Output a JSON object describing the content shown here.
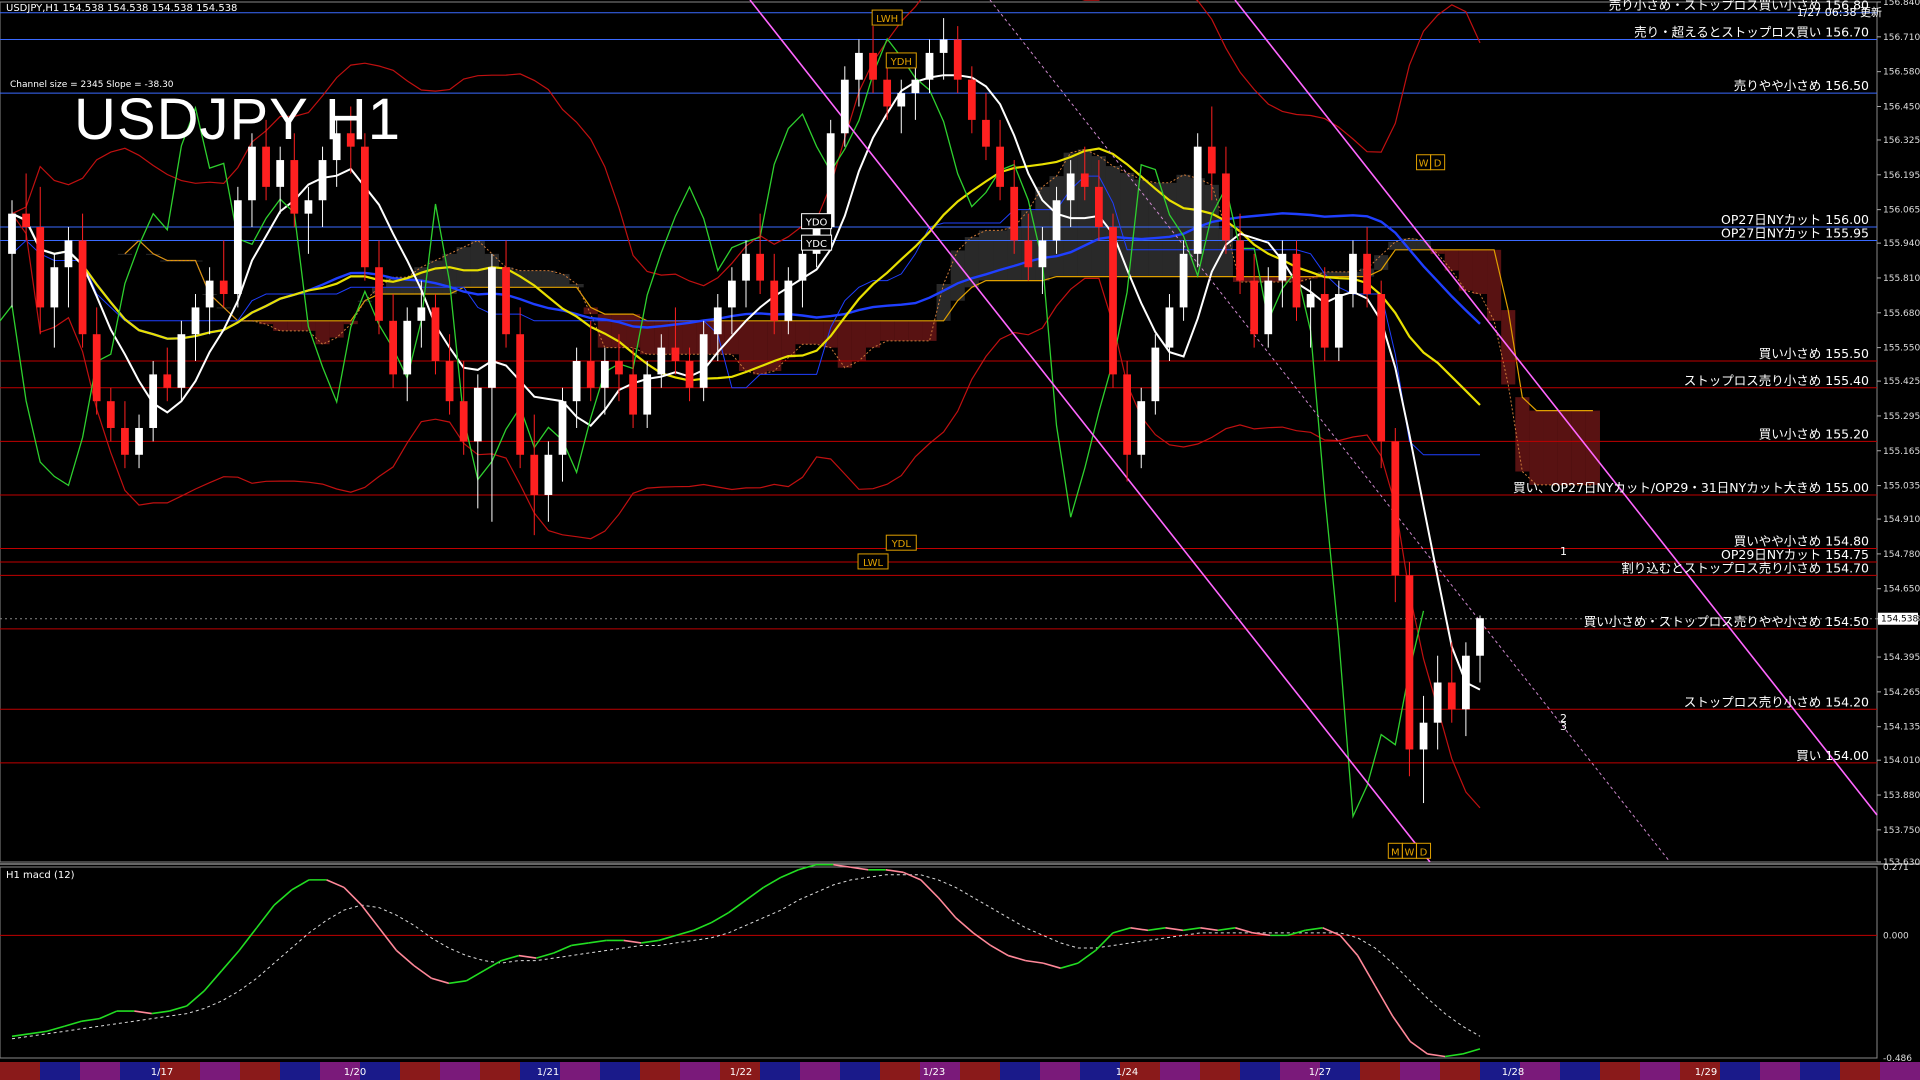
{
  "header": {
    "ohlc": "USDJPY,H1  154.538 154.538 154.538 154.538",
    "chart_title": "USDJPY H1",
    "channel_info": "Channel size = 2345 Slope = -38.30",
    "updated": "1/27 06:38 更新",
    "macd_label": "H1  macd (12)"
  },
  "colors": {
    "background": "#000000",
    "bull_candle": "#ffffff",
    "bear_candle": "#ff2020",
    "red_level": "#c00000",
    "blue_level": "#3a6aff",
    "cloud": "#a02020",
    "white_ma": "#ffffff",
    "yellow_ma": "#e8e000",
    "blue_ma": "#1f3fff",
    "green_line": "#2ed02e",
    "channel_magenta": "#ff66ff",
    "macd_pos": "#22dd22",
    "macd_neg": "#ff8899"
  },
  "chart_data": [
    {
      "type": "line",
      "title": "USDJPY H1",
      "ylim": [
        153.63,
        156.84
      ],
      "y_ticks": [
        156.84,
        156.71,
        156.58,
        156.45,
        156.325,
        156.195,
        156.065,
        155.94,
        155.81,
        155.68,
        155.55,
        155.425,
        155.295,
        155.165,
        155.035,
        154.91,
        154.78,
        154.65,
        154.538,
        154.395,
        154.265,
        154.135,
        154.01,
        153.88,
        153.75,
        153.63
      ],
      "x_labels": [
        "1/17",
        "1/20",
        "1/21",
        "1/22",
        "1/23",
        "1/24",
        "1/27",
        "1/28",
        "1/29"
      ],
      "current_price": 154.538,
      "levels": [
        {
          "price": 156.8,
          "label": "売り小さめ・ストップロス買い小さめ 156.80",
          "color": "blue"
        },
        {
          "price": 156.7,
          "label": "売り・超えるとストップロス買い 156.70",
          "color": "blue"
        },
        {
          "price": 156.5,
          "label": "売りやや小さめ 156.50",
          "color": "blue"
        },
        {
          "price": 156.0,
          "label": "OP27日NYカット 156.00",
          "color": "blue"
        },
        {
          "price": 155.95,
          "label": "OP27日NYカット 155.95",
          "color": "blue"
        },
        {
          "price": 155.5,
          "label": "買い小さめ 155.50",
          "color": "red"
        },
        {
          "price": 155.4,
          "label": "ストップロス売り小さめ 155.40",
          "color": "red"
        },
        {
          "price": 155.2,
          "label": "買い小さめ 155.20",
          "color": "red"
        },
        {
          "price": 155.0,
          "label": "買い、OP27日NYカット/OP29・31日NYカット大きめ 155.00",
          "color": "red"
        },
        {
          "price": 154.8,
          "label": "買いやや小さめ 154.80",
          "color": "red"
        },
        {
          "price": 154.75,
          "label": "OP29日NYカット 154.75",
          "color": "red"
        },
        {
          "price": 154.7,
          "label": "割り込むとストップロス売り小さめ 154.70",
          "color": "red"
        },
        {
          "price": 154.5,
          "label": "買い小さめ・ストップロス売りやや小さめ 154.50",
          "color": "red"
        },
        {
          "price": 154.2,
          "label": "ストップロス売り小さめ 154.20",
          "color": "red"
        },
        {
          "price": 154.0,
          "label": "買い 154.00",
          "color": "red"
        }
      ],
      "markers": [
        {
          "label": "LWH",
          "price": 156.78,
          "x_index": 62
        },
        {
          "label": "YDH",
          "price": 156.62,
          "x_index": 63
        },
        {
          "label": "YDO",
          "price": 156.02,
          "x_index": 57
        },
        {
          "label": "YDC",
          "price": 155.94,
          "x_index": 57
        },
        {
          "label": "YDL",
          "price": 154.82,
          "x_index": 63
        },
        {
          "label": "LWL",
          "price": 154.75,
          "x_index": 61
        },
        {
          "label": "W",
          "price": 156.24,
          "x_index": 100
        },
        {
          "label": "D",
          "price": 156.24,
          "x_index": 101
        },
        {
          "label": "M",
          "price": 153.67,
          "x_index": 98
        },
        {
          "label": "W",
          "price": 153.67,
          "x_index": 99
        },
        {
          "label": "D",
          "price": 153.67,
          "x_index": 100
        }
      ],
      "projections": [
        "1",
        "2",
        "3"
      ],
      "candles": [
        [
          155.9,
          156.1,
          155.7,
          156.05
        ],
        [
          156.05,
          156.2,
          155.95,
          156.0
        ],
        [
          156.0,
          156.15,
          155.6,
          155.7
        ],
        [
          155.7,
          155.9,
          155.55,
          155.85
        ],
        [
          155.85,
          156.0,
          155.7,
          155.95
        ],
        [
          155.95,
          156.05,
          155.55,
          155.6
        ],
        [
          155.6,
          155.7,
          155.3,
          155.35
        ],
        [
          155.35,
          155.4,
          155.2,
          155.25
        ],
        [
          155.25,
          155.35,
          155.1,
          155.15
        ],
        [
          155.15,
          155.3,
          155.1,
          155.25
        ],
        [
          155.25,
          155.5,
          155.2,
          155.45
        ],
        [
          155.45,
          155.55,
          155.35,
          155.4
        ],
        [
          155.4,
          155.65,
          155.35,
          155.6
        ],
        [
          155.6,
          155.75,
          155.5,
          155.7
        ],
        [
          155.7,
          155.85,
          155.6,
          155.8
        ],
        [
          155.8,
          155.95,
          155.7,
          155.75
        ],
        [
          155.75,
          156.15,
          155.7,
          156.1
        ],
        [
          156.1,
          156.35,
          156.0,
          156.3
        ],
        [
          156.3,
          156.4,
          156.1,
          156.15
        ],
        [
          156.15,
          156.3,
          156.05,
          156.25
        ],
        [
          156.25,
          156.35,
          156.0,
          156.05
        ],
        [
          156.05,
          156.15,
          155.9,
          156.1
        ],
        [
          156.1,
          156.3,
          156.0,
          156.25
        ],
        [
          156.25,
          156.4,
          156.15,
          156.35
        ],
        [
          156.35,
          156.45,
          156.2,
          156.3
        ],
        [
          156.3,
          156.35,
          155.8,
          155.85
        ],
        [
          155.85,
          155.95,
          155.6,
          155.65
        ],
        [
          155.65,
          155.75,
          155.4,
          155.45
        ],
        [
          155.45,
          155.7,
          155.35,
          155.65
        ],
        [
          155.65,
          155.8,
          155.55,
          155.7
        ],
        [
          155.7,
          155.75,
          155.45,
          155.5
        ],
        [
          155.5,
          155.6,
          155.3,
          155.35
        ],
        [
          155.35,
          155.5,
          155.15,
          155.2
        ],
        [
          155.2,
          155.45,
          154.95,
          155.4
        ],
        [
          155.4,
          155.9,
          154.9,
          155.85
        ],
        [
          155.85,
          155.95,
          155.55,
          155.6
        ],
        [
          155.6,
          155.7,
          155.1,
          155.15
        ],
        [
          155.15,
          155.3,
          154.85,
          155.0
        ],
        [
          155.0,
          155.2,
          154.9,
          155.15
        ],
        [
          155.15,
          155.4,
          155.05,
          155.35
        ],
        [
          155.35,
          155.55,
          155.25,
          155.5
        ],
        [
          155.5,
          155.65,
          155.35,
          155.4
        ],
        [
          155.4,
          155.55,
          155.3,
          155.5
        ],
        [
          155.5,
          155.6,
          155.35,
          155.45
        ],
        [
          155.45,
          155.55,
          155.25,
          155.3
        ],
        [
          155.3,
          155.5,
          155.25,
          155.45
        ],
        [
          155.45,
          155.6,
          155.4,
          155.55
        ],
        [
          155.55,
          155.7,
          155.45,
          155.5
        ],
        [
          155.5,
          155.55,
          155.35,
          155.4
        ],
        [
          155.4,
          155.65,
          155.35,
          155.6
        ],
        [
          155.6,
          155.75,
          155.5,
          155.7
        ],
        [
          155.7,
          155.85,
          155.6,
          155.8
        ],
        [
          155.8,
          155.95,
          155.7,
          155.9
        ],
        [
          155.9,
          156.05,
          155.75,
          155.8
        ],
        [
          155.8,
          155.9,
          155.6,
          155.65
        ],
        [
          155.65,
          155.85,
          155.6,
          155.8
        ],
        [
          155.8,
          155.95,
          155.7,
          155.9
        ],
        [
          155.9,
          156.05,
          155.85,
          156.0
        ],
        [
          156.0,
          156.4,
          155.95,
          156.35
        ],
        [
          156.35,
          156.6,
          156.3,
          156.55
        ],
        [
          156.55,
          156.7,
          156.45,
          156.65
        ],
        [
          156.65,
          156.75,
          156.5,
          156.55
        ],
        [
          156.55,
          156.65,
          156.4,
          156.45
        ],
        [
          156.45,
          156.55,
          156.35,
          156.5
        ],
        [
          156.5,
          156.6,
          156.4,
          156.55
        ],
        [
          156.55,
          156.7,
          156.5,
          156.65
        ],
        [
          156.65,
          156.78,
          156.55,
          156.7
        ],
        [
          156.7,
          156.75,
          156.5,
          156.55
        ],
        [
          156.55,
          156.6,
          156.35,
          156.4
        ],
        [
          156.4,
          156.5,
          156.25,
          156.3
        ],
        [
          156.3,
          156.4,
          156.1,
          156.15
        ],
        [
          156.15,
          156.25,
          155.9,
          155.95
        ],
        [
          155.95,
          156.05,
          155.8,
          155.85
        ],
        [
          155.85,
          156.0,
          155.75,
          155.95
        ],
        [
          155.95,
          156.15,
          155.9,
          156.1
        ],
        [
          156.1,
          156.25,
          156.0,
          156.2
        ],
        [
          156.2,
          156.3,
          156.1,
          156.15
        ],
        [
          156.15,
          156.25,
          155.95,
          156.0
        ],
        [
          156.0,
          156.05,
          155.4,
          155.45
        ],
        [
          155.45,
          155.5,
          155.05,
          155.15
        ],
        [
          155.15,
          155.4,
          155.1,
          155.35
        ],
        [
          155.35,
          155.6,
          155.3,
          155.55
        ],
        [
          155.55,
          155.75,
          155.5,
          155.7
        ],
        [
          155.7,
          155.95,
          155.65,
          155.9
        ],
        [
          155.9,
          156.35,
          155.85,
          156.3
        ],
        [
          156.3,
          156.45,
          156.1,
          156.2
        ],
        [
          156.2,
          156.3,
          155.9,
          155.95
        ],
        [
          155.95,
          156.05,
          155.75,
          155.8
        ],
        [
          155.8,
          155.9,
          155.55,
          155.6
        ],
        [
          155.6,
          155.85,
          155.55,
          155.8
        ],
        [
          155.8,
          155.95,
          155.7,
          155.9
        ],
        [
          155.9,
          155.95,
          155.65,
          155.7
        ],
        [
          155.7,
          155.8,
          155.55,
          155.75
        ],
        [
          155.75,
          155.85,
          155.5,
          155.55
        ],
        [
          155.55,
          155.8,
          155.5,
          155.75
        ],
        [
          155.75,
          155.95,
          155.7,
          155.9
        ],
        [
          155.9,
          156.0,
          155.7,
          155.75
        ],
        [
          155.75,
          155.8,
          155.1,
          155.2
        ],
        [
          155.2,
          155.25,
          154.6,
          154.7
        ],
        [
          154.7,
          154.75,
          153.95,
          154.05
        ],
        [
          154.05,
          154.25,
          153.85,
          154.15
        ],
        [
          154.15,
          154.4,
          154.05,
          154.3
        ],
        [
          154.3,
          154.45,
          154.15,
          154.2
        ],
        [
          154.2,
          154.45,
          154.1,
          154.4
        ],
        [
          154.4,
          154.55,
          154.3,
          154.54
        ]
      ]
    },
    {
      "type": "line",
      "title": "H1  macd (12)",
      "ylim": [
        -0.486,
        0.271
      ],
      "y_ticks": [
        0.271,
        0.0,
        -0.486
      ],
      "series": [
        {
          "name": "macd",
          "values": [
            -0.4,
            -0.39,
            -0.38,
            -0.36,
            -0.34,
            -0.33,
            -0.3,
            -0.3,
            -0.31,
            -0.3,
            -0.28,
            -0.22,
            -0.14,
            -0.06,
            0.03,
            0.12,
            0.18,
            0.22,
            0.22,
            0.19,
            0.12,
            0.03,
            -0.06,
            -0.12,
            -0.17,
            -0.19,
            -0.18,
            -0.14,
            -0.1,
            -0.08,
            -0.09,
            -0.07,
            -0.04,
            -0.03,
            -0.02,
            -0.02,
            -0.03,
            -0.02,
            0.0,
            0.02,
            0.05,
            0.09,
            0.14,
            0.19,
            0.23,
            0.26,
            0.28,
            0.28,
            0.27,
            0.26,
            0.26,
            0.25,
            0.22,
            0.15,
            0.07,
            0.01,
            -0.04,
            -0.08,
            -0.1,
            -0.11,
            -0.13,
            -0.11,
            -0.06,
            0.01,
            0.03,
            0.02,
            0.03,
            0.02,
            0.03,
            0.02,
            0.03,
            0.01,
            0.0,
            0.0,
            0.02,
            0.03,
            0.0,
            -0.08,
            -0.2,
            -0.32,
            -0.42,
            -0.47,
            -0.48,
            -0.47,
            -0.45
          ]
        },
        {
          "name": "signal",
          "values": [
            -0.41,
            -0.4,
            -0.39,
            -0.38,
            -0.37,
            -0.36,
            -0.35,
            -0.34,
            -0.33,
            -0.32,
            -0.31,
            -0.29,
            -0.26,
            -0.22,
            -0.17,
            -0.11,
            -0.05,
            0.01,
            0.06,
            0.1,
            0.12,
            0.11,
            0.08,
            0.04,
            -0.01,
            -0.05,
            -0.08,
            -0.1,
            -0.11,
            -0.1,
            -0.1,
            -0.09,
            -0.08,
            -0.07,
            -0.06,
            -0.05,
            -0.04,
            -0.04,
            -0.03,
            -0.02,
            -0.01,
            0.01,
            0.04,
            0.07,
            0.1,
            0.14,
            0.17,
            0.2,
            0.22,
            0.23,
            0.24,
            0.24,
            0.24,
            0.22,
            0.19,
            0.15,
            0.11,
            0.07,
            0.03,
            0.0,
            -0.03,
            -0.05,
            -0.05,
            -0.04,
            -0.03,
            -0.02,
            -0.01,
            0.0,
            0.01,
            0.01,
            0.01,
            0.01,
            0.01,
            0.01,
            0.01,
            0.01,
            0.01,
            -0.01,
            -0.05,
            -0.11,
            -0.18,
            -0.25,
            -0.31,
            -0.36,
            -0.4
          ]
        }
      ]
    }
  ]
}
